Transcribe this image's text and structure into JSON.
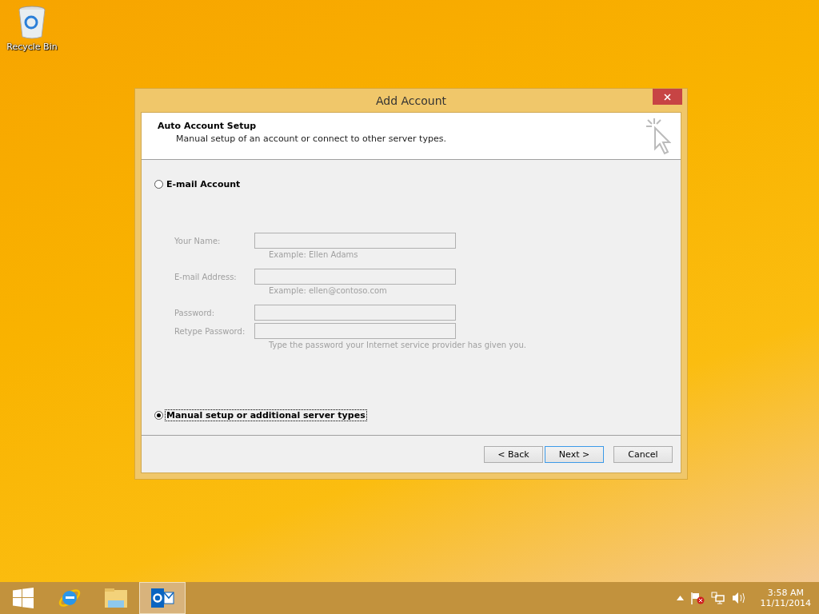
{
  "desktop": {
    "icons": [
      {
        "label": "Recycle Bin"
      }
    ]
  },
  "window": {
    "title": "Add Account",
    "header": {
      "title": "Auto Account Setup",
      "subtitle": "Manual setup of an account or connect to other server types."
    },
    "options": [
      {
        "label": "E-mail Account",
        "selected": false
      },
      {
        "label": "Manual setup or additional server types",
        "selected": true
      }
    ],
    "fields": [
      {
        "label": "Your Name:",
        "hint": "Example: Ellen Adams",
        "disabled": true
      },
      {
        "label": "E-mail Address:",
        "hint": "Example: ellen@contoso.com",
        "disabled": true
      },
      {
        "label": "Password:",
        "disabled": true
      },
      {
        "label": "Retype Password:",
        "hint": "Type the password your Internet service provider has given you.",
        "disabled": true
      }
    ],
    "buttons": [
      {
        "label": "< Back",
        "default": false
      },
      {
        "label": "Next >",
        "default": true
      },
      {
        "label": "Cancel",
        "default": false
      }
    ]
  },
  "taskbar": {
    "apps": [
      {
        "kind": "browser",
        "active": false
      },
      {
        "kind": "folder",
        "active": false
      },
      {
        "kind": "mail",
        "active": true
      }
    ],
    "time": "3:58 AM",
    "date": "11/11/2014"
  }
}
